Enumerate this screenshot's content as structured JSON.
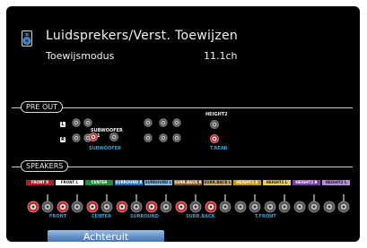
{
  "header": {
    "title": "Luidsprekers/Verst. Toewijzen",
    "mode_label": "Toewijsmodus",
    "mode_value": "11.1ch",
    "icon": "speaker-icon"
  },
  "pre_out": {
    "section_label": "PRE OUT",
    "left_marker": "L",
    "right_marker": "R",
    "subwoofer_heading": "SUBWOOFER",
    "sub_numbers": [
      "1",
      "2"
    ],
    "subwoofer_assignment": "SUBWOOFER",
    "height2_heading": "HEIGHT2",
    "height2_assignment": "T.REAR"
  },
  "speakers": {
    "section_label": "SPEAKERS",
    "terminals": [
      {
        "label": "FRONT R",
        "color": "#b01e28"
      },
      {
        "label": "FRONT L",
        "color": "#ffffff"
      },
      {
        "label": "CENTER",
        "color": "#1f8f3c"
      },
      {
        "label": "SURROUND R",
        "color": "#2b6fc0"
      },
      {
        "label": "SURROUND L",
        "color": "#7fb5e6"
      },
      {
        "label": "SURR.BACK R",
        "color": "#8a5a2a"
      },
      {
        "label": "SURR.BACK L",
        "color": "#c9a36e"
      },
      {
        "label": "HEIGHT1 R",
        "color": "#c79a16"
      },
      {
        "label": "HEIGHT1 L",
        "color": "#e8cc62"
      },
      {
        "label": "HEIGHT2 R",
        "color": "#7a3fa6"
      },
      {
        "label": "HEIGHT2 L",
        "color": "#b38ad6"
      }
    ],
    "assignments": [
      "FRONT",
      "CENTER",
      "SURROUND",
      "SURR.BACK",
      "T.FRONT"
    ]
  },
  "back_button": {
    "label": "Achteruit"
  },
  "colors": {
    "assigned": "#2aa6e3",
    "active_ring": "#c0282d",
    "background": "#000000"
  }
}
